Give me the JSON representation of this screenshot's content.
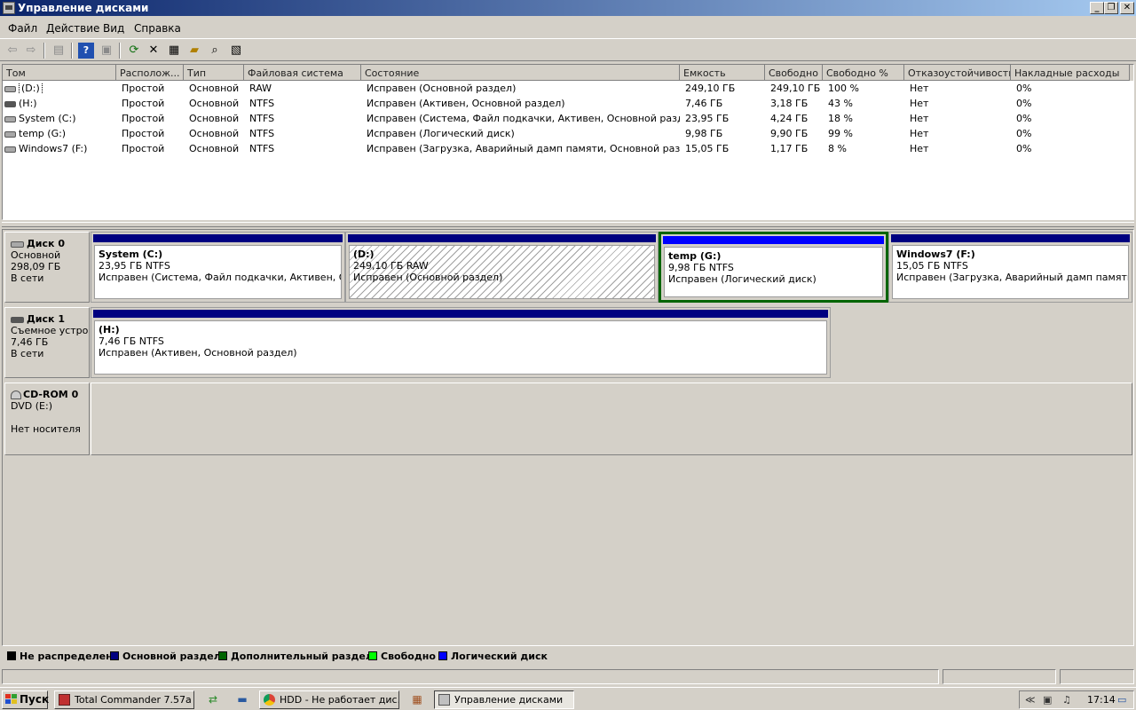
{
  "window": {
    "title": "Управление дисками",
    "btn_min": "_",
    "btn_restore": "❐",
    "btn_close": "✕"
  },
  "menu": [
    "Файл",
    "Действие",
    "Вид",
    "Справка"
  ],
  "toolbar": [
    "back-icon",
    "forward-icon",
    "console-tree-icon",
    "help-icon",
    "properties-pane-icon",
    "refresh-icon",
    "delete-icon",
    "properties-icon",
    "open-icon",
    "search-icon",
    "show-hide-icon"
  ],
  "volumes": {
    "headers": [
      "Том",
      "Располож...",
      "Тип",
      "Файловая система",
      "Состояние",
      "Емкость",
      "Свободно",
      "Свободно %",
      "Отказоустойчивость",
      "Накладные расходы"
    ],
    "rows": [
      [
        "(D:)",
        "Простой",
        "Основной",
        "RAW",
        "Исправен (Основной раздел)",
        "249,10 ГБ",
        "249,10 ГБ",
        "100 %",
        "Нет",
        "0%"
      ],
      [
        "(H:)",
        "Простой",
        "Основной",
        "NTFS",
        "Исправен (Активен, Основной раздел)",
        "7,46 ГБ",
        "3,18 ГБ",
        "43 %",
        "Нет",
        "0%"
      ],
      [
        "System (C:)",
        "Простой",
        "Основной",
        "NTFS",
        "Исправен (Система, Файл подкачки, Активен, Основной раздел)",
        "23,95 ГБ",
        "4,24 ГБ",
        "18 %",
        "Нет",
        "0%"
      ],
      [
        "temp (G:)",
        "Простой",
        "Основной",
        "NTFS",
        "Исправен (Логический диск)",
        "9,98 ГБ",
        "9,90 ГБ",
        "99 %",
        "Нет",
        "0%"
      ],
      [
        "Windows7 (F:)",
        "Простой",
        "Основной",
        "NTFS",
        "Исправен (Загрузка, Аварийный дамп памяти, Основной раздел)",
        "15,05 ГБ",
        "1,17 ГБ",
        "8 %",
        "Нет",
        "0%"
      ]
    ]
  },
  "disks": [
    {
      "name": "Диск 0",
      "type": "Основной",
      "size": "298,09 ГБ",
      "status": "В сети",
      "partitions": [
        {
          "name": "System  (C:)",
          "size": "23,95 ГБ NTFS",
          "status": "Исправен (Система, Файл подкачки, Активен, Основной раздел)"
        },
        {
          "name": "(D:)",
          "size": "249,10 ГБ RAW",
          "status": "Исправен (Основной раздел)"
        },
        {
          "name": "temp  (G:)",
          "size": "9,98 ГБ NTFS",
          "status": "Исправен (Логический диск)"
        },
        {
          "name": "Windows7  (F:)",
          "size": "15,05 ГБ NTFS",
          "status": "Исправен (Загрузка, Аварийный дамп памяти, Основной раздел)"
        }
      ]
    },
    {
      "name": "Диск 1",
      "type": "Съемное устройство",
      "size": "7,46 ГБ",
      "status": "В сети",
      "partitions": [
        {
          "name": "(H:)",
          "size": "7,46 ГБ NTFS",
          "status": "Исправен (Активен, Основной раздел)"
        }
      ]
    },
    {
      "name": "CD-ROM 0",
      "type": "DVD (E:)",
      "status": "Нет носителя"
    }
  ],
  "legend": [
    {
      "label": "Не распределен",
      "color": "#000000"
    },
    {
      "label": "Основной раздел",
      "color": "#000080"
    },
    {
      "label": "Дополнительный раздел",
      "color": "#006400"
    },
    {
      "label": "Свободно",
      "color": "#00ff00"
    },
    {
      "label": "Логический диск",
      "color": "#0000ff"
    }
  ],
  "taskbar": {
    "start": "Пуск",
    "tasks": [
      "Total Commander 7.57a ...",
      "HDD - Не работает дис...",
      "Управление дисками"
    ],
    "clock": "17:14"
  }
}
